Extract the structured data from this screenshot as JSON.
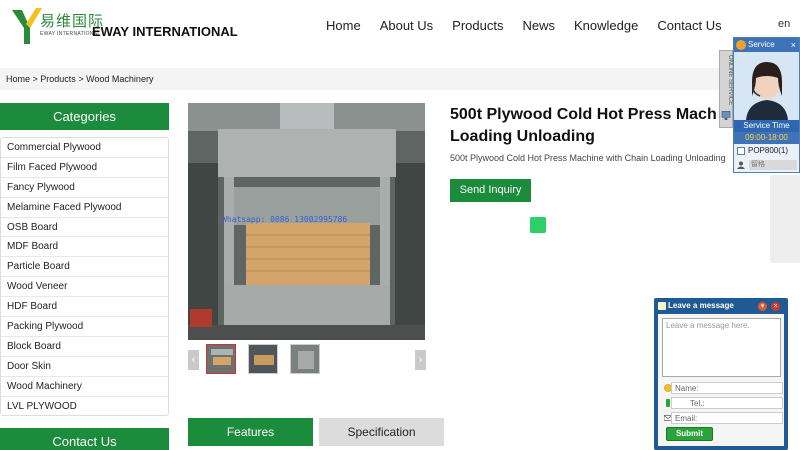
{
  "header": {
    "logo_cn": "易维国际",
    "logo_sub": "EWAY INTERNATIONAL",
    "logo_en": "EWAY INTERNATIONAL",
    "nav": [
      "Home",
      "About Us",
      "Products",
      "News",
      "Knowledge",
      "Contact Us"
    ],
    "lang": "en"
  },
  "breadcrumb": {
    "items": [
      "Home",
      "Products",
      "Wood Machinery"
    ],
    "separator": " > "
  },
  "sidebar": {
    "title": "Categories",
    "items": [
      "Commercial Plywood",
      "Film Faced Plywood",
      "Fancy Plywood",
      "Melamine Faced Plywood",
      "OSB Board",
      "MDF Board",
      "Particle Board",
      "Wood Veneer",
      "HDF Board",
      "Packing Plywood",
      "Block Board",
      "Door Skin",
      "Wood Machinery",
      "LVL PLYWOOD"
    ],
    "contact_title": "Contact Us"
  },
  "product": {
    "title_line1": "500t Plywood Cold Hot Press Mach",
    "title_line2": "Loading Unloading",
    "description": "500t Plywood Cold Hot Press Machine with Chain Loading Unloading",
    "inquiry_label": "Send Inquiry",
    "image_watermark": "Whatsapp: 0086 13002995786",
    "thumb_prev": "‹",
    "thumb_next": "›"
  },
  "tabs": {
    "features": "Features",
    "specification": "Specification"
  },
  "service": {
    "title": "Service",
    "close": "×",
    "strip_text": "ONLINE SERVICE",
    "time_label": "Service Time",
    "time": "09:00-18:00",
    "agent": "POP800(1)",
    "input_placeholder": "留格"
  },
  "message": {
    "title": "Leave a message",
    "textarea_placeholder": "Leave a message here.",
    "name_label": "Name:",
    "tel_label": "Tel.:",
    "email_label": "Email:",
    "submit": "Submit"
  },
  "colors": {
    "brand_green": "#1b8b3c",
    "accent_green": "#2ecf6a",
    "widget_blue": "#1f5a94"
  }
}
